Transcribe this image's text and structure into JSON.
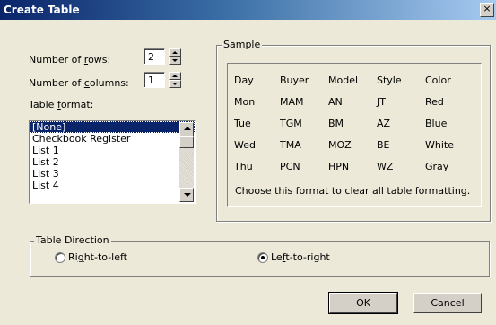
{
  "window": {
    "title": "Create Table",
    "close_glyph": "×"
  },
  "rows": {
    "label_pre": "Number of ",
    "label_key": "r",
    "label_post": "ows:",
    "value": "2"
  },
  "columns": {
    "label_pre": "Number of ",
    "label_key": "c",
    "label_post": "olumns:",
    "value": "1"
  },
  "format": {
    "label_pre": "Table ",
    "label_key": "f",
    "label_post": "ormat:",
    "items": [
      "[None]",
      "Checkbook Register",
      "List 1",
      "List 2",
      "List 3",
      "List 4"
    ],
    "selected_index": 0
  },
  "sample": {
    "title": "Sample",
    "rows": [
      [
        "Day",
        "Buyer",
        "Model",
        "Style",
        "Color"
      ],
      [
        "Mon",
        "MAM",
        "AN",
        "JT",
        "Red"
      ],
      [
        "Tue",
        "TGM",
        "BM",
        "AZ",
        "Blue"
      ],
      [
        "Wed",
        "TMA",
        "MOZ",
        "BE",
        "White"
      ],
      [
        "Thu",
        "PCN",
        "HPN",
        "WZ",
        "Gray"
      ]
    ],
    "description": "Choose this format to clear all table formatting."
  },
  "direction": {
    "title": "Table Direction",
    "rtl": {
      "pre": "Ri",
      "key": "g",
      "post": "ht-to-left",
      "checked": false
    },
    "ltr": {
      "pre": "Le",
      "key": "f",
      "post": "t-to-right",
      "checked": true
    }
  },
  "buttons": {
    "ok": "OK",
    "cancel": "Cancel"
  },
  "colors": {
    "titlebar": "#0a246a",
    "face": "#ece9d8",
    "selection": "#0a246a"
  }
}
